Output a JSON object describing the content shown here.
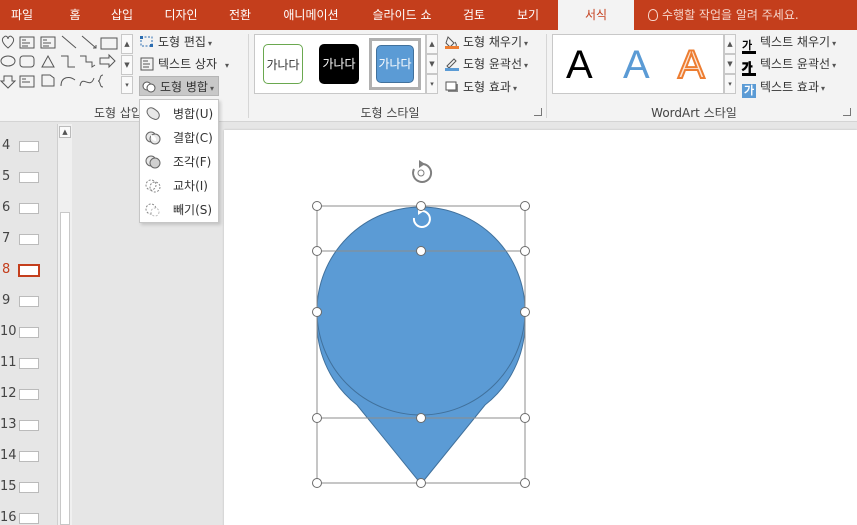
{
  "tabs": [
    {
      "label": "파일",
      "active": false
    },
    {
      "label": "홈",
      "active": false
    },
    {
      "label": "삽입",
      "active": false
    },
    {
      "label": "디자인",
      "active": false
    },
    {
      "label": "전환",
      "active": false
    },
    {
      "label": "애니메이션",
      "active": false
    },
    {
      "label": "슬라이드 쇼",
      "active": false
    },
    {
      "label": "검토",
      "active": false
    },
    {
      "label": "보기",
      "active": false
    },
    {
      "label": "서식",
      "active": true
    }
  ],
  "tell_me": "수행할 작업을 알려 주세요.",
  "ribbon": {
    "insert_shapes": {
      "label": "도형 삽입",
      "edit_shape": "도형 편집",
      "text_box": "텍스트 상자",
      "merge_shapes": "도형 병합"
    },
    "shape_styles": {
      "label": "도형 스타일",
      "swatch_text": "가나다",
      "fill": "도형 채우기",
      "outline": "도형 윤곽선",
      "effects": "도형 효과"
    },
    "wordart_styles": {
      "label": "WordArt 스타일",
      "letter": "A",
      "text_fill": "텍스트 채우기",
      "text_outline": "텍스트 윤곽선",
      "text_effects": "텍스트 효과",
      "fill_icon_glyph": "가",
      "outline_icon_glyph": "가",
      "effects_icon_glyph": "가"
    }
  },
  "merge_menu": [
    {
      "label": "병합(U)"
    },
    {
      "label": "결합(C)"
    },
    {
      "label": "조각(F)"
    },
    {
      "label": "교차(I)"
    },
    {
      "label": "빼기(S)"
    }
  ],
  "slides": [
    {
      "number": "4",
      "active": false
    },
    {
      "number": "5",
      "active": false
    },
    {
      "number": "6",
      "active": false
    },
    {
      "number": "7",
      "active": false
    },
    {
      "number": "8",
      "active": true
    },
    {
      "number": "9",
      "active": false
    },
    {
      "number": "10",
      "active": false
    },
    {
      "number": "11",
      "active": false
    },
    {
      "number": "12",
      "active": false
    },
    {
      "number": "13",
      "active": false
    },
    {
      "number": "14",
      "active": false
    },
    {
      "number": "15",
      "active": false
    },
    {
      "number": "16",
      "active": false
    }
  ],
  "colors": {
    "accent": "#c43e1c",
    "shape_fill": "#5b9bd5",
    "shape_stroke": "#41719c"
  }
}
